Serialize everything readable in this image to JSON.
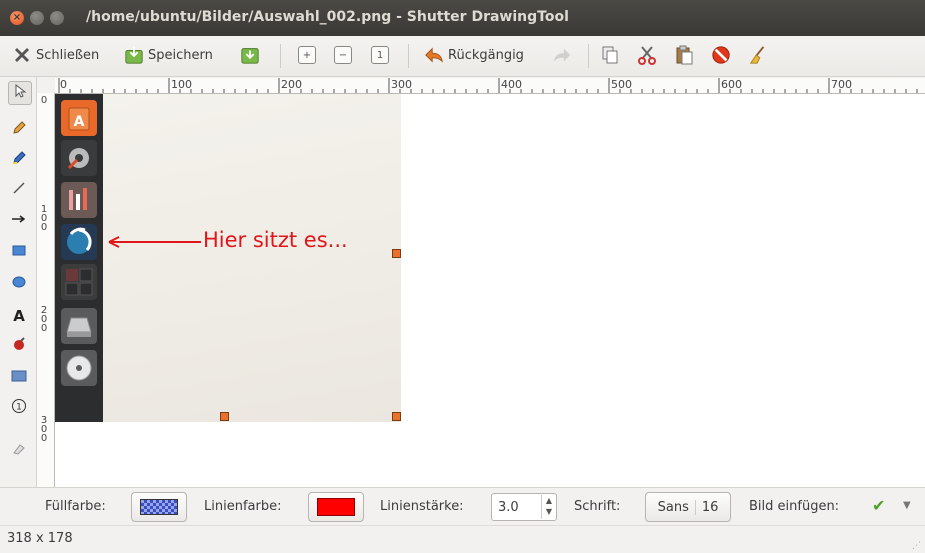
{
  "window": {
    "title": "/home/ubuntu/Bilder/Auswahl_002.png - Shutter DrawingTool"
  },
  "toolbar": {
    "close_label": "Schließen",
    "save_label": "Speichern",
    "undo_label": "Rückgängig"
  },
  "rulers": {
    "h_labels": [
      "0",
      "100",
      "200",
      "300",
      "400",
      "500",
      "600",
      "700"
    ],
    "v_labels": [
      "0",
      "1\n0\n0",
      "2\n0\n0",
      "3\n0\n0"
    ]
  },
  "annotation": {
    "text": "Hier sitzt es..."
  },
  "bottombar": {
    "fill_label": "Füllfarbe:",
    "line_color_label": "Linienfarbe:",
    "line_width_label": "Linienstärke:",
    "line_width_value": "3.0",
    "font_label": "Schrift:",
    "font_name": "Sans",
    "font_size": "16",
    "insert_image_label": "Bild einfügen:"
  },
  "colors": {
    "line_color": "#ff0000",
    "accent": "#e0161a",
    "title_bar": "#3c3b37"
  },
  "status": {
    "dimensions": "318 x 178"
  }
}
